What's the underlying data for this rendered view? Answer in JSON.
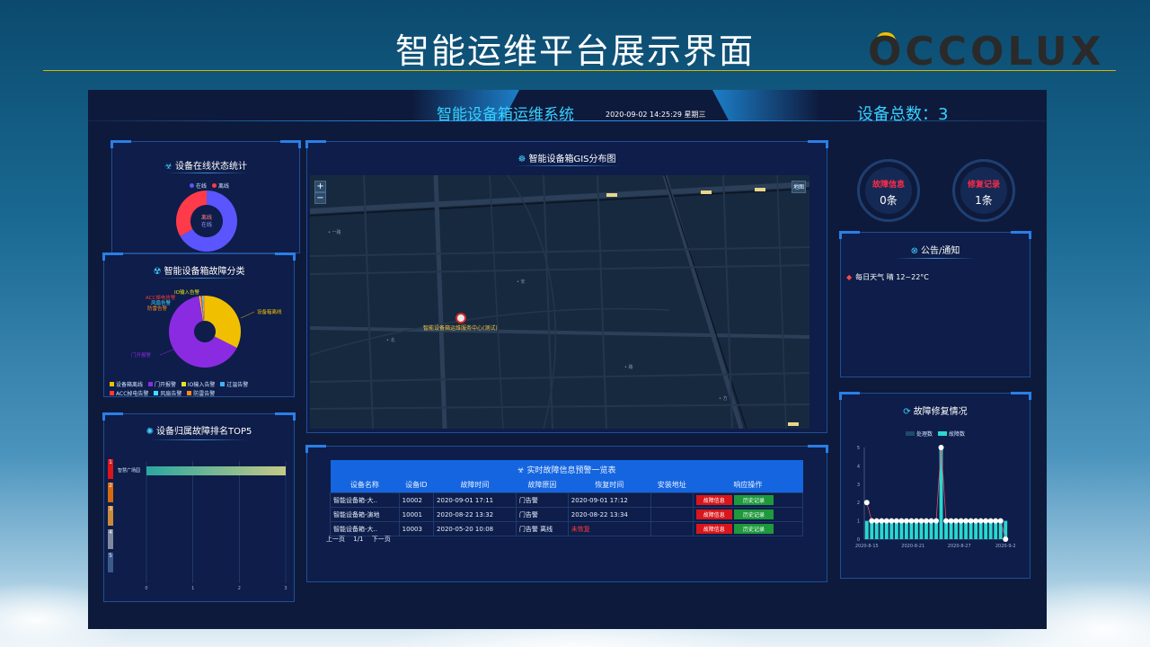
{
  "slide": {
    "title": "智能运维平台展示界面",
    "brand": "OCCOLUX",
    "brand_color": "#2a2a2a",
    "accent": "#f2c000"
  },
  "dashboard": {
    "title": "智能设备箱运维系统",
    "datetime": "2020-09-02 14:25:29 星期三",
    "device_total": "设备总数：3"
  },
  "online_status": {
    "title": "设备在线状态统计",
    "legend": [
      {
        "label": "在线",
        "color": "#5a55ff"
      },
      {
        "label": "离线",
        "color": "#ff3a4a"
      }
    ],
    "center_text": "离线\n在线"
  },
  "fault_category": {
    "title": "智能设备箱故障分类",
    "slice_labels": {
      "yellow": "设备箱离线",
      "purple": "门开报警",
      "top1": "IO输入告警",
      "top2": "ACC掉电告警",
      "top3": "风扇告警",
      "top4": "防雷告警"
    },
    "legend": [
      {
        "label": "设备箱离线",
        "color": "#f0c000"
      },
      {
        "label": "门开报警",
        "color": "#8a2be2"
      },
      {
        "label": "IO输入告警",
        "color": "#e4e41a"
      },
      {
        "label": "过温告警",
        "color": "#39b4ff"
      },
      {
        "label": "ACC掉电告警",
        "color": "#ff3a3a"
      },
      {
        "label": "风扇告警",
        "color": "#3fe0ff"
      },
      {
        "label": "防雷告警",
        "color": "#ff8a1a"
      }
    ]
  },
  "top5": {
    "title": "设备归属故障排名TOP5",
    "ranks": [
      "1",
      "2",
      "3",
      "4",
      "5"
    ],
    "rank_colors": [
      "#d9161b",
      "#d56a10",
      "#c98a3a",
      "#7f8aa0",
      "#3a5a8a"
    ],
    "first_label": "智慧广场园",
    "x_ticks": [
      "0",
      "1",
      "2",
      "3"
    ]
  },
  "gis": {
    "title": "智能设备箱GIS分布图",
    "zoom_in": "+",
    "zoom_out": "−",
    "layer_button": "地图",
    "marker_label": "智能设备箱运维服务中心(测试)"
  },
  "fault_info": {
    "label": "故障信息",
    "value": "0条",
    "color": "#ff2a4a"
  },
  "repair_record": {
    "label": "修复记录",
    "value": "1条",
    "color": "#ff2a4a"
  },
  "notice": {
    "title": "公告/通知",
    "items": [
      "每日天气 晴 12~22°C"
    ]
  },
  "repair_chart": {
    "title": "故障修复情况",
    "legend": [
      {
        "label": "处理数",
        "color": "#1c4a6a"
      },
      {
        "label": "故障数",
        "color": "#29d8d0"
      }
    ]
  },
  "alarm_table": {
    "title": "实时故障信息预警一览表",
    "columns": [
      "设备名称",
      "设备ID",
      "故障时间",
      "故障原因",
      "恢复时间",
      "安装地址",
      "响应操作"
    ],
    "rows": [
      {
        "name": "智能设备箱-大..",
        "id": "10002",
        "fault_time": "2020-09-01 17:11",
        "reason": "门告警",
        "recover": "2020-09-01 17:12",
        "address": "",
        "btn1": "故障信息",
        "btn2": "历史记录"
      },
      {
        "name": "智能设备箱-演地",
        "id": "10001",
        "fault_time": "2020-08-22 13:32",
        "reason": "门告警",
        "recover": "2020-08-22 13:34",
        "address": "",
        "btn1": "故障信息",
        "btn2": "历史记录"
      },
      {
        "name": "智能设备箱-大..",
        "id": "10003",
        "fault_time": "2020-05-20 10:08",
        "reason": "门告警 离线",
        "recover": "未恢复",
        "address": "",
        "btn1": "故障信息",
        "btn2": "历史记录"
      }
    ],
    "pager": {
      "prev": "上一页",
      "page": "1/1",
      "next": "下一页"
    }
  },
  "chart_data": [
    {
      "type": "pie",
      "title": "设备在线状态统计",
      "categories": [
        "在线",
        "离线"
      ],
      "values": [
        2,
        1
      ],
      "colors": [
        "#5a55ff",
        "#ff3a4a"
      ]
    },
    {
      "type": "pie",
      "title": "智能设备箱故障分类",
      "categories": [
        "设备箱离线",
        "门开报警",
        "IO输入告警",
        "ACC掉电告警",
        "风扇告警",
        "防雷告警"
      ],
      "values": [
        1,
        2,
        0.02,
        0.02,
        0.02,
        0.02
      ],
      "colors": [
        "#f0c000",
        "#8a2be2",
        "#e4e41a",
        "#ff3a3a",
        "#3fe0ff",
        "#ff8a1a"
      ]
    },
    {
      "type": "bar",
      "title": "设备归属故障排名TOP5",
      "categories": [
        "智慧广场园"
      ],
      "values": [
        3
      ],
      "xlim": [
        0,
        3
      ],
      "x_ticks": [
        0,
        1,
        2,
        3
      ],
      "orientation": "horizontal"
    },
    {
      "type": "bar",
      "title": "故障修复情况",
      "x_labels": [
        "2020-8-15",
        "2020-8-21",
        "2020-8-27",
        "2020-9-2"
      ],
      "y_ticks": [
        0,
        1,
        2,
        3,
        4,
        5
      ],
      "ylim": [
        0,
        5
      ],
      "series": [
        {
          "name": "故障数",
          "values": [
            1,
            1,
            1,
            1,
            1,
            1,
            1,
            1,
            1,
            1,
            1,
            1,
            1,
            1,
            1,
            5,
            1,
            1,
            1,
            1,
            1,
            1,
            1,
            1,
            1,
            1,
            1,
            1,
            1
          ]
        },
        {
          "name": "处理数",
          "values": [
            2,
            1,
            1,
            1,
            1,
            1,
            1,
            1,
            1,
            1,
            1,
            1,
            1,
            1,
            1,
            5,
            1,
            1,
            1,
            1,
            1,
            1,
            1,
            1,
            1,
            1,
            1,
            1,
            0
          ]
        }
      ]
    }
  ]
}
